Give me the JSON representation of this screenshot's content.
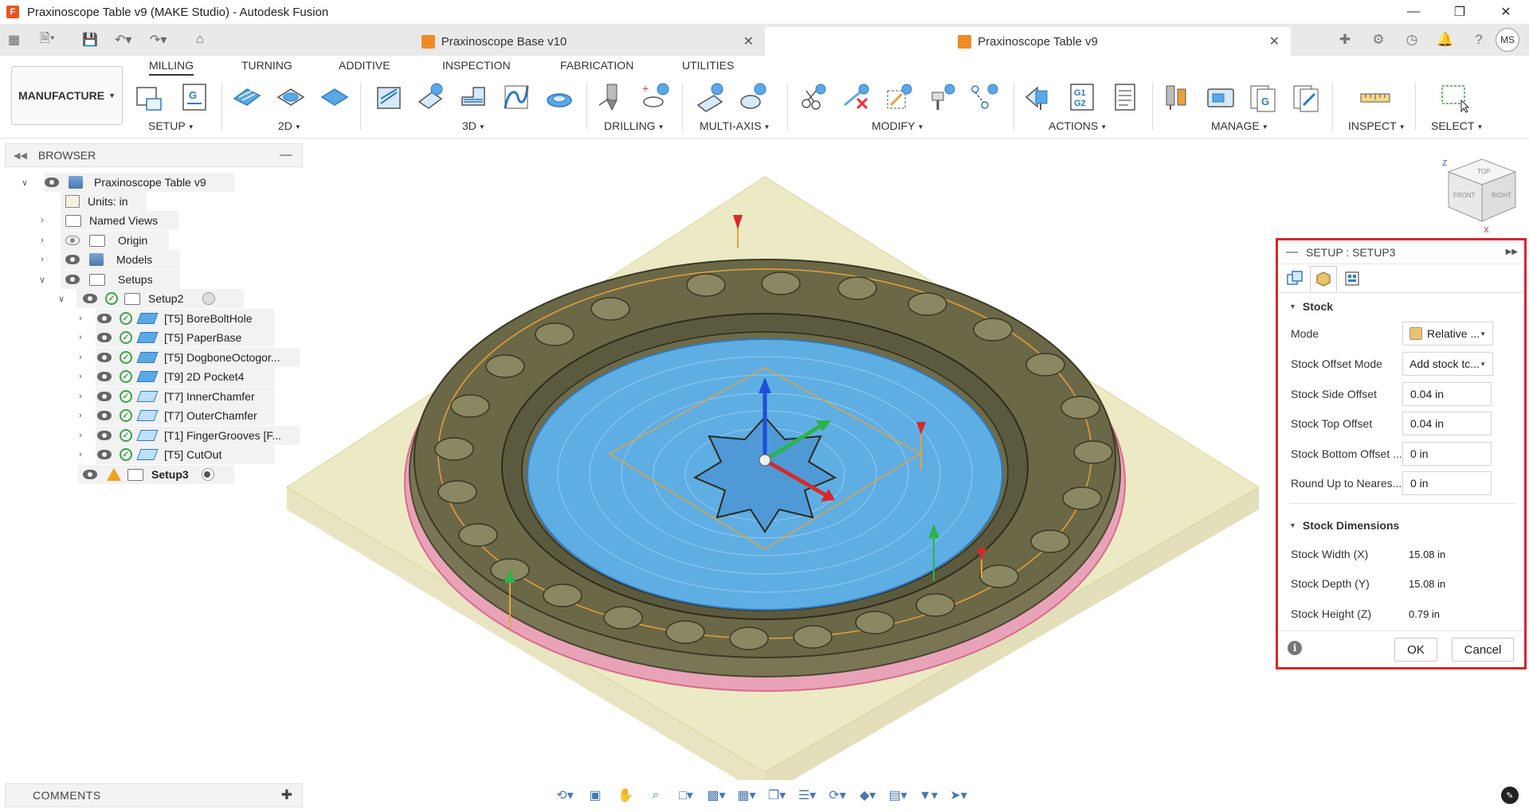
{
  "window": {
    "title": "Praxinoscope Table v9 (MAKE Studio) - Autodesk Fusion",
    "app_icon": "F",
    "controls": [
      "minimize-icon",
      "restore-icon",
      "close-icon"
    ]
  },
  "tabs": [
    {
      "label": "Praxinoscope Base v10",
      "active": false
    },
    {
      "label": "Praxinoscope Table v9",
      "active": true
    }
  ],
  "user": {
    "initials": "MS"
  },
  "workspace": {
    "label": "MANUFACTURE"
  },
  "toolbar_tabs": [
    "MILLING",
    "TURNING",
    "ADDITIVE",
    "INSPECTION",
    "FABRICATION",
    "UTILITIES"
  ],
  "toolbar_groups": [
    "SETUP",
    "2D",
    "3D",
    "DRILLING",
    "MULTI-AXIS",
    "MODIFY",
    "ACTIONS",
    "MANAGE",
    "INSPECT",
    "SELECT"
  ],
  "actions_g_code": {
    "g1": "G1",
    "g2": "G2"
  },
  "browser": {
    "title": "BROWSER",
    "root": "Praxinoscope Table v9",
    "units": "Units: in",
    "named_views": "Named Views",
    "origin": "Origin",
    "models": "Models",
    "setups": "Setups",
    "setup2": "Setup2",
    "operations": [
      "[T5] BoreBoltHole",
      "[T5] PaperBase",
      "[T5] DogboneOctogor...",
      "[T9] 2D Pocket4",
      "[T7] InnerChamfer",
      "[T7] OuterChamfer",
      "[T1] FingerGrooves [F...",
      "[T5] CutOut"
    ],
    "setup3": "Setup3"
  },
  "comments": {
    "label": "COMMENTS"
  },
  "dialog": {
    "title": "SETUP : SETUP3",
    "stock_section": "Stock",
    "mode_label": "Mode",
    "mode_value": "Relative ...",
    "offset_mode_label": "Stock Offset Mode",
    "offset_mode_value": "Add stock tc...",
    "side_offset_label": "Stock Side Offset",
    "side_offset_value": "0.04 in",
    "top_offset_label": "Stock Top Offset",
    "top_offset_value": "0.04 in",
    "bottom_offset_label": "Stock Bottom Offset ...",
    "bottom_offset_value": "0 in",
    "round_up_label": "Round Up to Neares...",
    "round_up_value": "0 in",
    "dims_section": "Stock Dimensions",
    "width_label": "Stock Width (X)",
    "width_value": "15.08 in",
    "depth_label": "Stock Depth (Y)",
    "depth_value": "15.08 in",
    "height_label": "Stock Height (Z)",
    "height_value": "0.79 in",
    "ok": "OK",
    "cancel": "Cancel"
  },
  "viewcube": {
    "top": "TOP",
    "front": "FRONT",
    "right": "RIGHT",
    "z": "Z",
    "x": "X"
  },
  "colors": {
    "accent_red": "#d9262b",
    "toolpath_blue": "#4aa3df",
    "part_olive": "#6b6847",
    "stock_yellow": "#e6e3b0",
    "stock_pink": "#e79ab2"
  }
}
